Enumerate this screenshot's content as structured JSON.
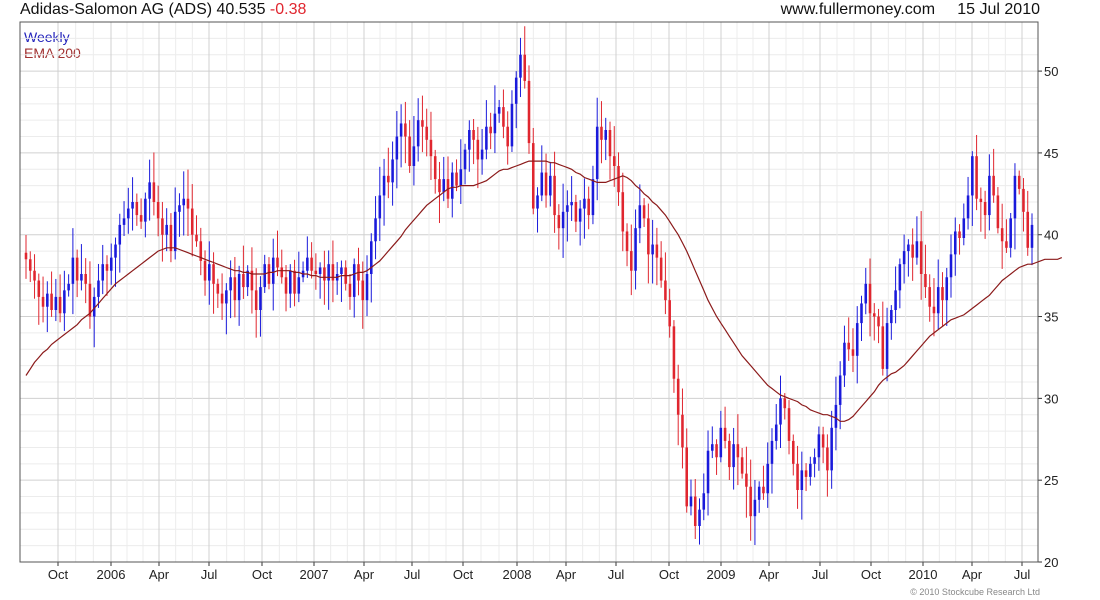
{
  "header": {
    "title": "Adidas-Salomon AG (ADS) 40.535",
    "change": "-0.38",
    "site": "www.fullermoney.com",
    "date": "15 Jul 2010"
  },
  "legend": {
    "weekly": "Weekly",
    "ema": "EMA 200"
  },
  "copyright": "© 2010 Stockcube Research Ltd",
  "colors": {
    "up": "#1a1adb",
    "down": "#e0262f",
    "ema": "#8b1a1a",
    "grid": "#d0d0d0"
  },
  "chart_data": {
    "type": "line",
    "title": "Adidas-Salomon AG (ADS) 40.535",
    "xlabel": "",
    "ylabel": "",
    "ylim": [
      20,
      53
    ],
    "yticks": [
      20,
      25,
      30,
      35,
      40,
      45,
      50
    ],
    "xticks": [
      "Oct",
      "2006",
      "Apr",
      "Jul",
      "Oct",
      "2007",
      "Apr",
      "Jul",
      "Oct",
      "2008",
      "Apr",
      "Jul",
      "Oct",
      "2009",
      "Apr",
      "Jul",
      "Oct",
      "2010",
      "Apr",
      "Jul"
    ],
    "grid": true,
    "legend_position": "top-left",
    "series": [
      {
        "name": "Weekly",
        "note": "weekly closing prices (candlestick bodies)",
        "values": [
          38.5,
          37.8,
          37.2,
          36.2,
          35.6,
          36.4,
          35.4,
          36.2,
          35.2,
          36.6,
          37.0,
          38.6,
          37.2,
          37.6,
          37.0,
          35.0,
          36.2,
          37.2,
          38.2,
          37.8,
          38.6,
          39.4,
          40.6,
          41.0,
          41.6,
          42.0,
          41.2,
          40.8,
          42.2,
          43.2,
          42.0,
          41.0,
          40.0,
          40.6,
          39.0,
          41.4,
          41.8,
          42.2,
          41.6,
          40.0,
          39.6,
          38.4,
          37.2,
          38.2,
          37.0,
          36.4,
          35.8,
          36.6,
          37.4,
          36.0,
          37.6,
          36.8,
          37.8,
          36.6,
          35.4,
          36.8,
          38.2,
          37.0,
          38.6,
          38.0,
          37.4,
          36.4,
          37.8,
          36.4,
          37.4,
          37.8,
          38.6,
          37.8,
          37.6,
          38.0,
          37.2,
          38.2,
          37.2,
          37.6,
          38.0,
          37.0,
          36.2,
          38.2,
          37.2,
          36.0,
          37.6,
          39.6,
          41.0,
          42.4,
          43.6,
          43.2,
          44.6,
          46.0,
          46.8,
          46.0,
          44.2,
          45.4,
          47.0,
          46.6,
          45.8,
          44.8,
          43.4,
          42.6,
          43.4,
          42.2,
          43.8,
          43.0,
          44.0,
          45.2,
          46.4,
          45.8,
          44.6,
          45.2,
          46.6,
          46.2,
          47.4,
          47.8,
          46.6,
          45.4,
          48.0,
          49.6,
          51.0,
          49.4,
          45.6,
          41.6,
          42.4,
          43.8,
          42.4,
          43.6,
          41.2,
          40.4,
          41.4,
          41.8,
          42.0,
          40.8,
          41.6,
          42.2,
          41.2,
          43.4,
          46.6,
          45.8,
          46.4,
          44.8,
          44.2,
          42.6,
          40.2,
          39.0,
          37.8,
          40.4,
          41.8,
          41.0,
          38.8,
          39.4,
          38.6,
          37.2,
          36.0,
          34.4,
          31.2,
          29.0,
          27.0,
          23.4,
          24.0,
          22.2,
          23.2,
          24.2,
          26.8,
          27.2,
          26.4,
          28.2,
          27.4,
          25.8,
          27.2,
          26.4,
          25.4,
          24.6,
          22.8,
          23.8,
          24.6,
          24.2,
          26.0,
          27.4,
          28.4,
          30.0,
          29.4,
          27.4,
          26.0,
          24.4,
          25.6,
          25.2,
          26.0,
          26.4,
          27.8,
          27.0,
          25.6,
          28.2,
          29.6,
          31.4,
          33.4,
          33.0,
          32.6,
          34.6,
          35.8,
          37.0,
          35.2,
          35.0,
          34.4,
          31.8,
          34.6,
          35.4,
          36.6,
          38.2,
          39.0,
          39.4,
          38.6,
          39.6,
          37.6,
          36.8,
          35.6,
          35.2,
          36.8,
          36.0,
          37.4,
          38.8,
          40.2,
          39.8,
          41.0,
          42.4,
          44.8,
          42.2,
          42.0,
          41.2,
          43.6,
          42.4,
          40.4,
          39.6,
          39.2,
          41.0,
          43.6,
          42.8,
          41.4,
          39.2,
          40.6
        ],
        "color": "#1a1adb"
      },
      {
        "name": "EMA 200",
        "values": [
          31.4,
          31.8,
          32.2,
          32.5,
          32.8,
          33.0,
          33.3,
          33.5,
          33.7,
          33.9,
          34.1,
          34.3,
          34.5,
          34.8,
          35.0,
          35.2,
          35.5,
          35.8,
          36.1,
          36.4,
          36.7,
          37.0,
          37.2,
          37.4,
          37.6,
          37.8,
          38.0,
          38.2,
          38.4,
          38.6,
          38.8,
          39.0,
          39.1,
          39.2,
          39.2,
          39.2,
          39.1,
          39.0,
          38.9,
          38.8,
          38.7,
          38.6,
          38.5,
          38.4,
          38.3,
          38.2,
          38.1,
          38.0,
          37.9,
          37.8,
          37.8,
          37.7,
          37.7,
          37.6,
          37.6,
          37.6,
          37.6,
          37.7,
          37.7,
          37.8,
          37.8,
          37.8,
          37.8,
          37.7,
          37.7,
          37.6,
          37.6,
          37.5,
          37.5,
          37.4,
          37.4,
          37.4,
          37.4,
          37.4,
          37.5,
          37.5,
          37.5,
          37.6,
          37.7,
          37.7,
          37.8,
          38.0,
          38.2,
          38.4,
          38.7,
          39.0,
          39.3,
          39.6,
          39.9,
          40.3,
          40.6,
          40.9,
          41.2,
          41.5,
          41.8,
          42.0,
          42.2,
          42.4,
          42.6,
          42.8,
          42.9,
          42.9,
          43.0,
          43.0,
          43.0,
          43.0,
          43.1,
          43.2,
          43.3,
          43.5,
          43.7,
          43.9,
          44.0,
          44.0,
          44.1,
          44.2,
          44.3,
          44.4,
          44.5,
          44.5,
          44.5,
          44.5,
          44.5,
          44.4,
          44.4,
          44.3,
          44.2,
          44.1,
          44.0,
          43.8,
          43.7,
          43.5,
          43.4,
          43.3,
          43.2,
          43.2,
          43.2,
          43.3,
          43.4,
          43.5,
          43.6,
          43.5,
          43.3,
          43.0,
          42.8,
          42.5,
          42.3,
          42.0,
          41.8,
          41.5,
          41.2,
          40.8,
          40.4,
          40.0,
          39.5,
          39.0,
          38.4,
          37.8,
          37.2,
          36.6,
          36.0,
          35.5,
          35.0,
          34.6,
          34.2,
          33.8,
          33.4,
          33.0,
          32.6,
          32.3,
          32.0,
          31.7,
          31.4,
          31.1,
          30.8,
          30.6,
          30.4,
          30.2,
          30.1,
          30.0,
          29.9,
          29.8,
          29.6,
          29.5,
          29.3,
          29.2,
          29.1,
          29.0,
          29.0,
          28.9,
          28.8,
          28.6,
          28.6,
          28.7,
          28.9,
          29.2,
          29.5,
          29.8,
          30.1,
          30.4,
          30.8,
          31.1,
          31.3,
          31.5,
          31.6,
          31.8,
          32.0,
          32.3,
          32.6,
          32.9,
          33.2,
          33.5,
          33.8,
          34.0,
          34.2,
          34.4,
          34.6,
          34.8,
          34.9,
          35.0,
          35.1,
          35.3,
          35.5,
          35.7,
          35.9,
          36.1,
          36.3,
          36.6,
          36.9,
          37.2,
          37.4,
          37.6,
          37.8,
          38.0,
          38.1,
          38.2,
          38.2,
          38.3,
          38.4,
          38.5,
          38.5,
          38.5,
          38.5,
          38.6
        ],
        "color": "#8b1a1a"
      }
    ]
  }
}
